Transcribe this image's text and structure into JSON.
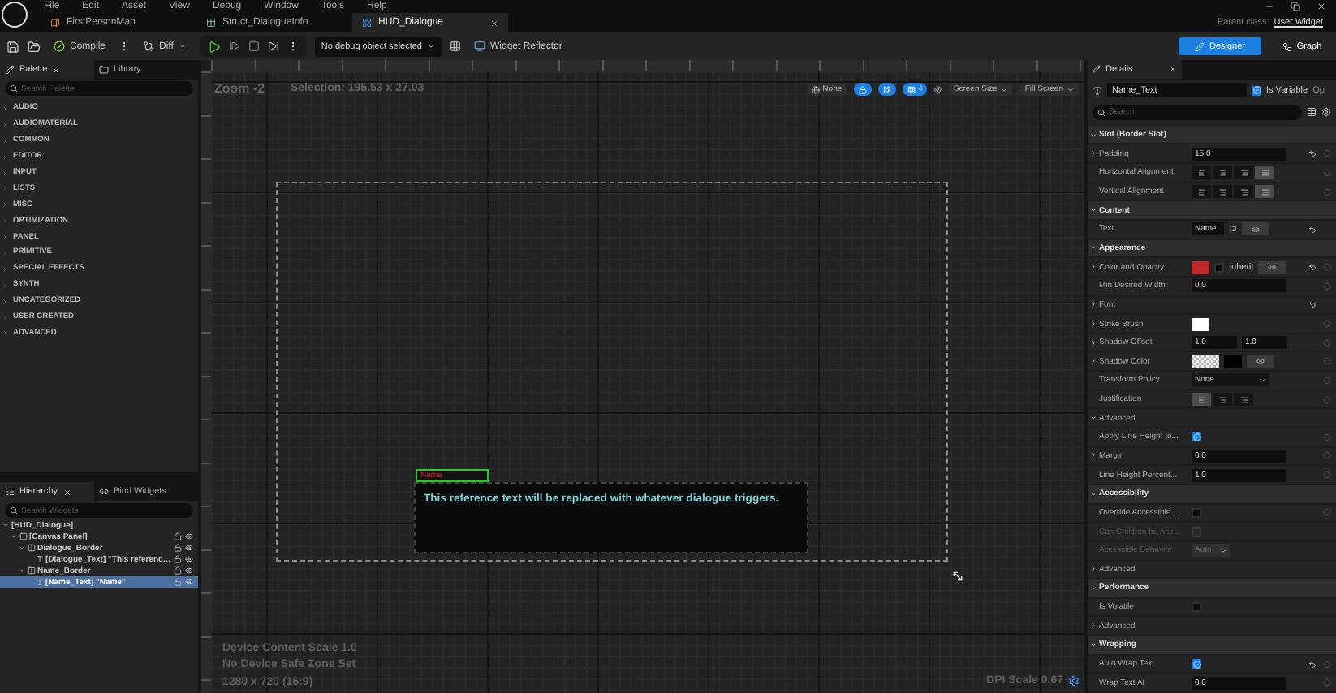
{
  "menu": [
    "File",
    "Edit",
    "Asset",
    "View",
    "Debug",
    "Window",
    "Tools",
    "Help"
  ],
  "tabs": [
    {
      "label": "FirstPersonMap",
      "selected": false,
      "kind": "map"
    },
    {
      "label": "Struct_DialogueInfo",
      "selected": false,
      "kind": "struct"
    },
    {
      "label": "HUD_Dialogue",
      "selected": true,
      "kind": "widget"
    }
  ],
  "parent_class": {
    "label": "Parent class:",
    "value": "User Widget"
  },
  "toolbar": {
    "compile": "Compile",
    "diff": "Diff",
    "debug_object": "No debug object selected",
    "widget_reflector": "Widget Reflector"
  },
  "modes": [
    {
      "label": "Designer",
      "selected": true,
      "kind": "designer"
    },
    {
      "label": "Graph",
      "selected": false,
      "kind": "graph"
    }
  ],
  "palette": {
    "tabs": [
      {
        "label": "Palette",
        "selected": true,
        "kind": "palette"
      },
      {
        "label": "Library",
        "selected": false,
        "kind": "library"
      }
    ],
    "search_placeholder": "Search Palette",
    "categories": [
      "AUDIO",
      "AUDIOMATERIAL",
      "COMMON",
      "EDITOR",
      "INPUT",
      "LISTS",
      "MISC",
      "OPTIMIZATION",
      "PANEL",
      "PRIMITIVE",
      "SPECIAL EFFECTS",
      "SYNTH",
      "UNCATEGORIZED",
      "USER CREATED",
      "ADVANCED"
    ]
  },
  "hierarchy": {
    "tabs": [
      {
        "label": "Hierarchy",
        "selected": true,
        "kind": "hierarchy"
      },
      {
        "label": "Bind Widgets",
        "selected": false,
        "kind": "bind"
      }
    ],
    "search_placeholder": "Search Widgets",
    "tree": [
      {
        "label": "[HUD_Dialogue]",
        "selected": false,
        "expanded": true,
        "children": [
          {
            "label": "[Canvas Panel]",
            "kind": "canvas",
            "selected": false,
            "expanded": true,
            "children": [
              {
                "label": "Dialogue_Border",
                "kind": "border",
                "selected": false,
                "expanded": true,
                "children": [
                  {
                    "label": "[Dialogue_Text] \"This referenc…",
                    "kind": "text",
                    "selected": false
                  }
                ]
              },
              {
                "label": "Name_Border",
                "kind": "border",
                "selected": false,
                "expanded": true,
                "children": [
                  {
                    "label": "[Name_Text] \"Name\"",
                    "kind": "text",
                    "selected": true
                  }
                ]
              }
            ]
          }
        ]
      }
    ]
  },
  "canvas": {
    "zoom": "Zoom -2",
    "selection": "Selection: 195.53 x 27.03",
    "locale": "None",
    "grid_snap": "4",
    "screen_size": "Screen Size",
    "fill_mode": "Fill Screen",
    "name_text": "Name",
    "dialogue_text": "This reference text will be replaced with whatever dialogue triggers.",
    "info": [
      "Device Content Scale 1.0",
      "No Device Safe Zone Set",
      "1280 x 720 (16:9)"
    ],
    "dpi": "DPI Scale 0.67"
  },
  "details": {
    "title": "Details",
    "widget_name": "Name_Text",
    "is_variable": {
      "label": "Is Variable",
      "checked": true
    },
    "cut_label": "Op",
    "search_placeholder": "Search",
    "rows": [
      {
        "kind": "section",
        "label": "Slot (Border Slot)",
        "expanded": true
      },
      {
        "kind": "number",
        "label": "Padding",
        "value": "15.0",
        "expandable": true,
        "reset": true,
        "keyable": true
      },
      {
        "kind": "align",
        "label": "Horizontal Alignment",
        "options": [
          {
            "selected": false
          },
          {
            "selected": false
          },
          {
            "selected": false
          },
          {
            "selected": true
          }
        ],
        "keyable": true
      },
      {
        "kind": "align",
        "label": "Vertical Alignment",
        "options": [
          {
            "selected": false
          },
          {
            "selected": false
          },
          {
            "selected": false
          },
          {
            "selected": true
          }
        ],
        "keyable": true
      },
      {
        "kind": "section",
        "label": "Content",
        "expanded": true
      },
      {
        "kind": "text",
        "label": "Text",
        "value": "Name",
        "reset": true
      },
      {
        "kind": "section",
        "label": "Appearance",
        "expanded": true
      },
      {
        "kind": "color",
        "label": "Color and Opacity",
        "color": "#c0282a",
        "inherit": {
          "label": "Inherit",
          "checked": false
        },
        "expandable": true,
        "reset": true,
        "keyable": true
      },
      {
        "kind": "number",
        "label": "Min Desired Width",
        "value": "0.0",
        "keyable": true
      },
      {
        "kind": "plain",
        "label": "Font",
        "expandable": true,
        "reset": true
      },
      {
        "kind": "swatch",
        "label": "Strike Brush",
        "expandable": true,
        "keyable": true
      },
      {
        "kind": "pair",
        "label": "Shadow Offset",
        "values": [
          "1.0",
          "1.0"
        ],
        "expandable": true,
        "keyable": true
      },
      {
        "kind": "shadow",
        "label": "Shadow Color",
        "expandable": true,
        "keyable": true
      },
      {
        "kind": "dropdown",
        "label": "Transform Policy",
        "value": "None",
        "keyable": true
      },
      {
        "kind": "align",
        "label": "Justification",
        "options": [
          {
            "selected": true
          },
          {
            "selected": false
          },
          {
            "selected": false
          }
        ],
        "keyable": true
      },
      {
        "kind": "group",
        "label": "Advanced",
        "expanded": true
      },
      {
        "kind": "check",
        "label": "Apply Line Height to...",
        "checked": true,
        "keyable": true
      },
      {
        "kind": "number",
        "label": "Margin",
        "value": "0.0",
        "expandable": true,
        "keyable": true
      },
      {
        "kind": "number",
        "label": "Line Height Percent...",
        "value": "1.0",
        "keyable": true
      },
      {
        "kind": "section",
        "label": "Accessibility",
        "expanded": true
      },
      {
        "kind": "check",
        "label": "Override Accessible...",
        "checked": false,
        "keyable": true
      },
      {
        "kind": "check",
        "label": "Can Children be Acc...",
        "checked": false,
        "disabled": true
      },
      {
        "kind": "dropdown",
        "label": "Accessible Behavior",
        "value": "Auto",
        "disabled": true
      },
      {
        "kind": "group",
        "label": "Advanced",
        "expanded": false
      },
      {
        "kind": "section",
        "label": "Performance",
        "expanded": true
      },
      {
        "kind": "check",
        "label": "Is Volatile",
        "checked": false
      },
      {
        "kind": "group",
        "label": "Advanced",
        "expanded": false
      },
      {
        "kind": "section",
        "label": "Wrapping",
        "expanded": true
      },
      {
        "kind": "check",
        "label": "Auto Wrap Text",
        "checked": true,
        "reset": true,
        "keyable": true
      },
      {
        "kind": "number",
        "label": "Wrap Text At",
        "value": "0.0",
        "keyable": true
      }
    ]
  }
}
